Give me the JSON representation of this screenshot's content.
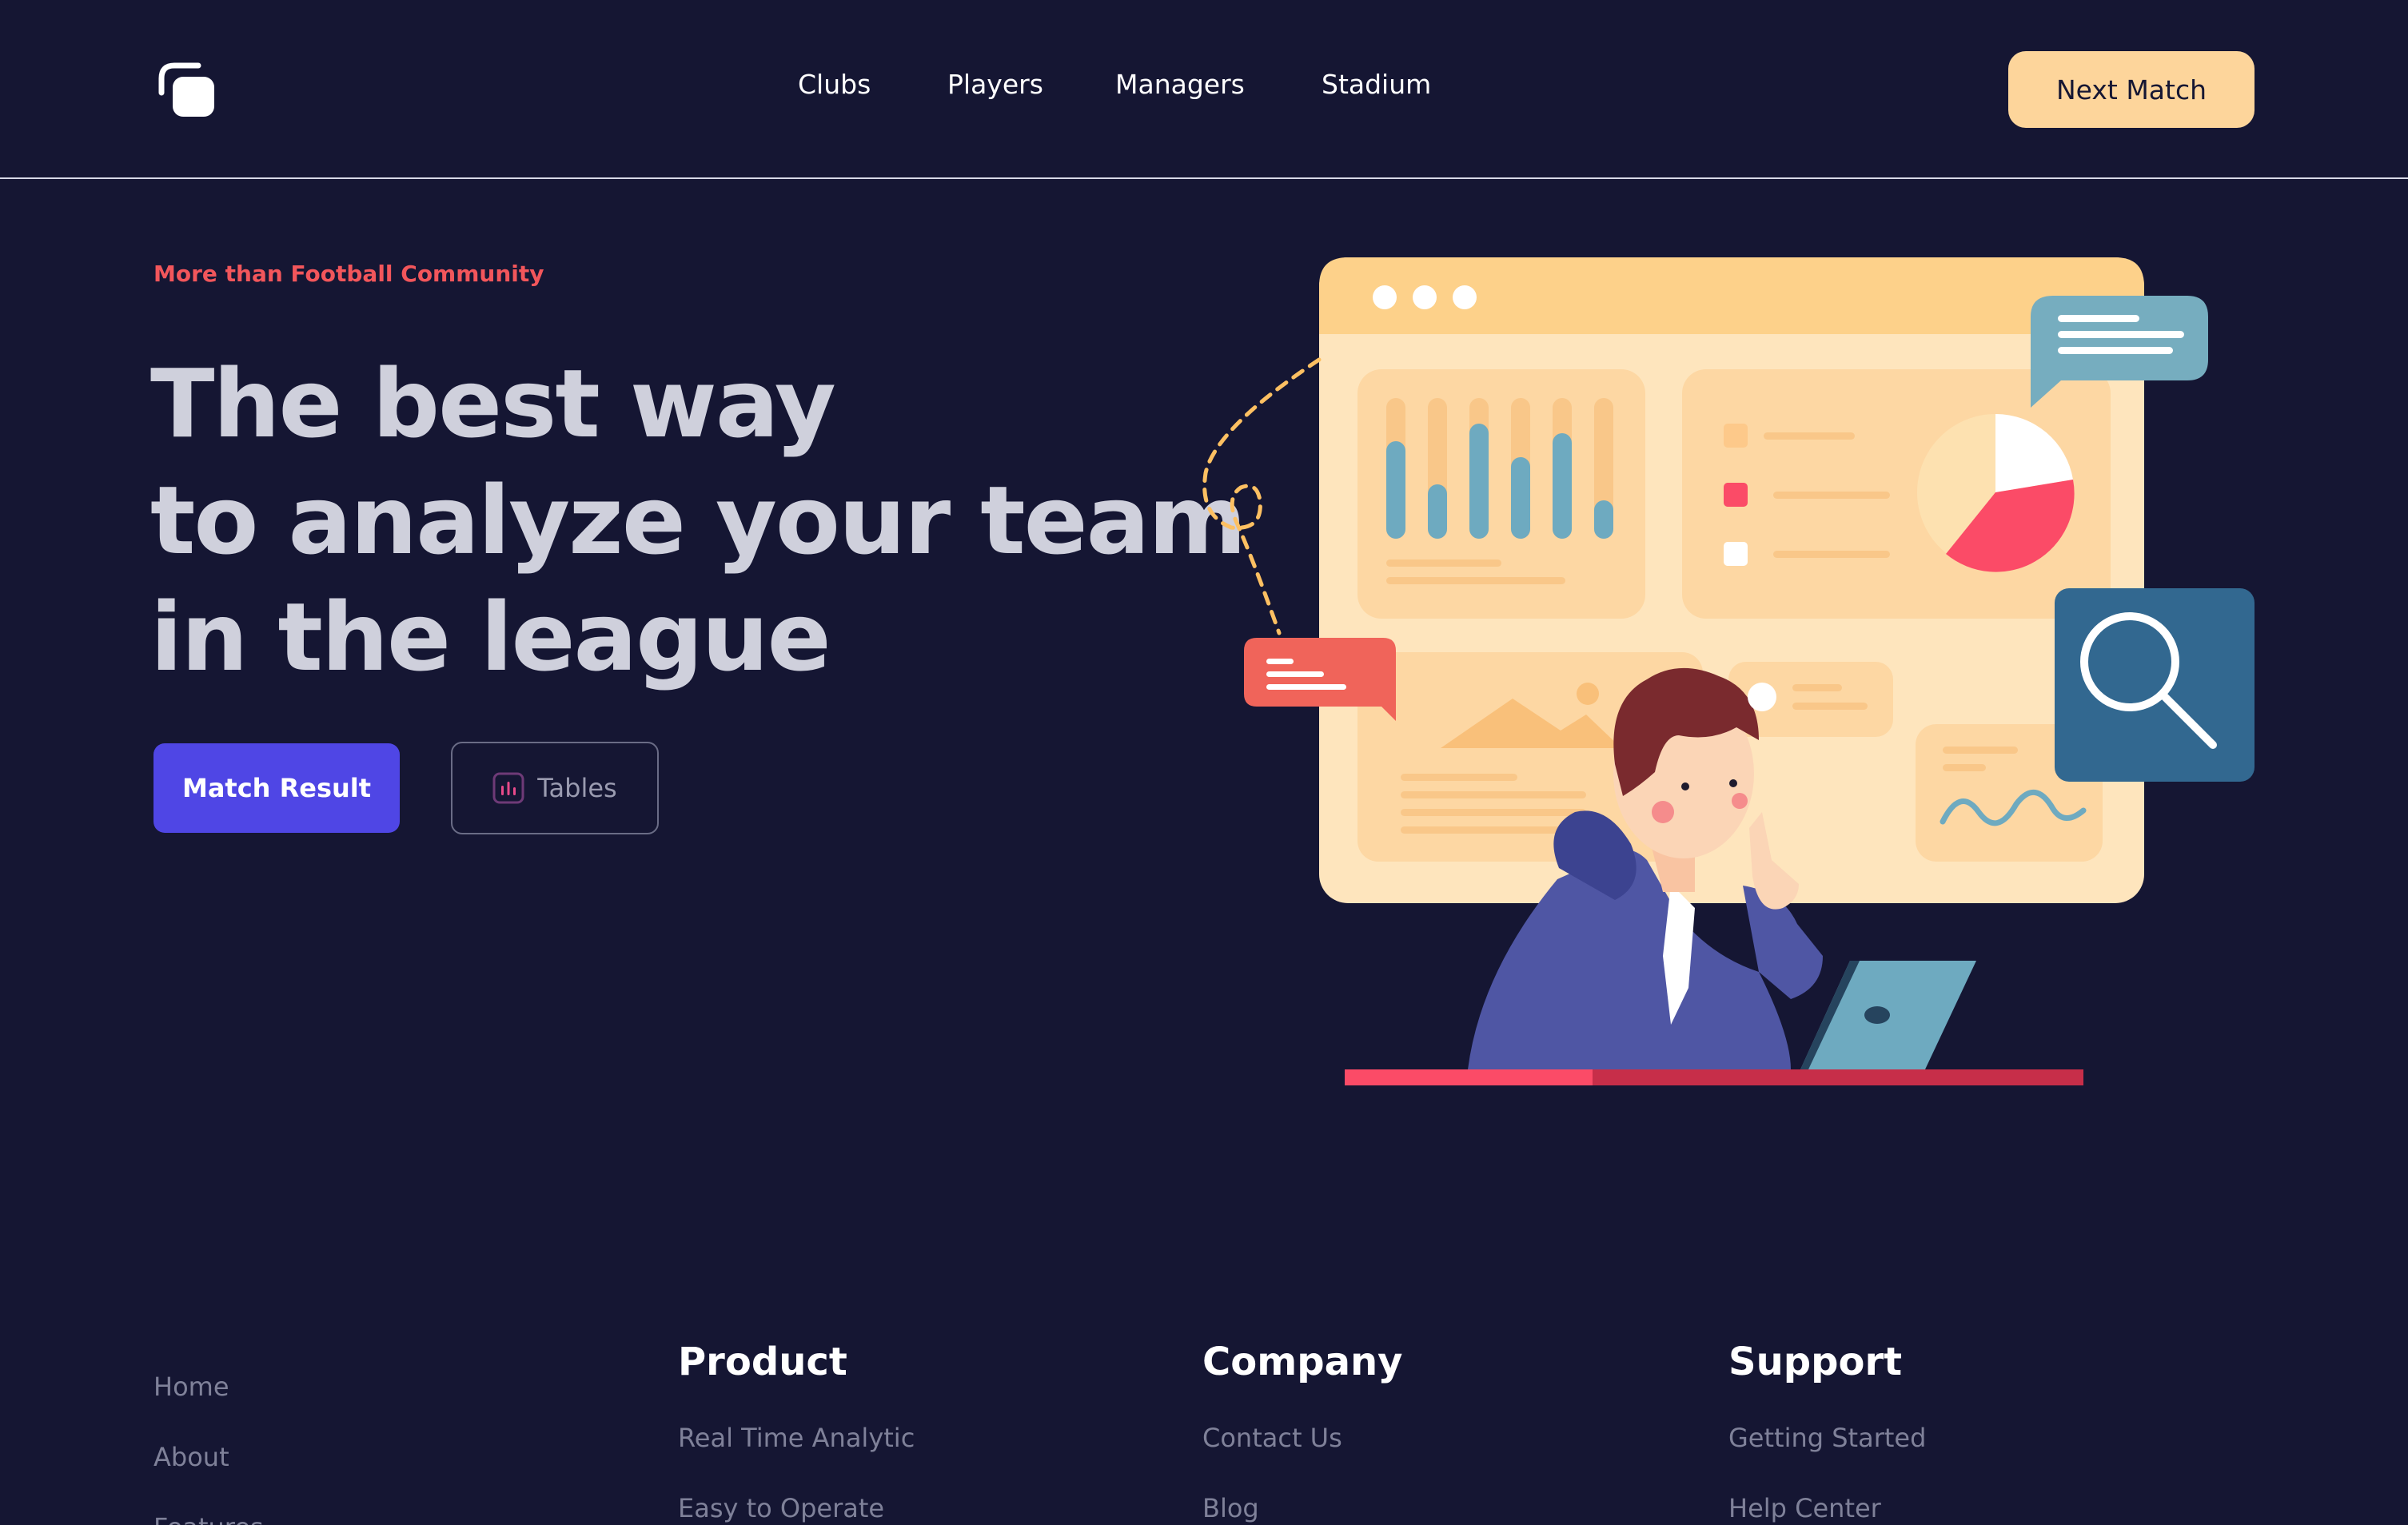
{
  "header": {
    "logo_icon": "stacked-squares-logo-icon",
    "nav": [
      "Clubs",
      "Players",
      "Managers",
      "Stadium"
    ],
    "cta_label": "Next Match"
  },
  "hero": {
    "eyebrow": "More than Football Community",
    "headline": [
      "The best way",
      "to analyze your team",
      "in the league"
    ],
    "primary_button": "Match Result",
    "secondary_button": "Tables",
    "secondary_button_icon": "bar-chart-icon"
  },
  "illustration": {
    "icon": "magnifier-icon"
  },
  "footer": {
    "col1": [
      "Home",
      "About",
      "Features"
    ],
    "product": {
      "heading": "Product",
      "links": [
        "Real Time Analytic",
        "Easy to Operate"
      ]
    },
    "company": {
      "heading": "Company",
      "links": [
        "Contact Us",
        "Blog"
      ]
    },
    "support": {
      "heading": "Support",
      "links": [
        "Getting Started",
        "Help Center"
      ]
    }
  },
  "colors": {
    "background": "#151633",
    "accent": "#4f46e5",
    "cta": "#fdd59b",
    "eyebrow": "#f2565b",
    "heading": "#cfd0dc",
    "footer_link": "#7f8199"
  }
}
